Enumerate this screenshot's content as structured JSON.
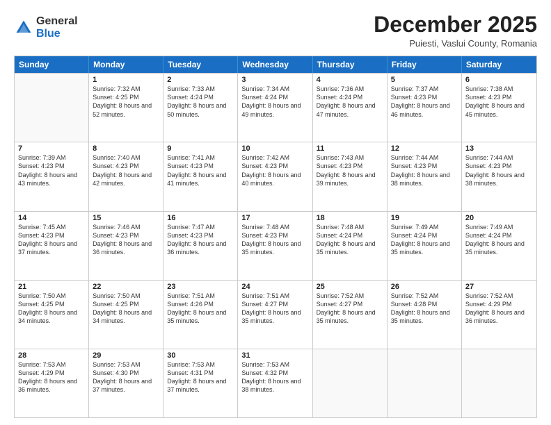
{
  "logo": {
    "general": "General",
    "blue": "Blue"
  },
  "title": "December 2025",
  "location": "Puiesti, Vaslui County, Romania",
  "days_of_week": [
    "Sunday",
    "Monday",
    "Tuesday",
    "Wednesday",
    "Thursday",
    "Friday",
    "Saturday"
  ],
  "weeks": [
    [
      {
        "day": "",
        "sunrise": "",
        "sunset": "",
        "daylight": ""
      },
      {
        "day": "1",
        "sunrise": "7:32 AM",
        "sunset": "4:25 PM",
        "daylight": "8 hours and 52 minutes."
      },
      {
        "day": "2",
        "sunrise": "7:33 AM",
        "sunset": "4:24 PM",
        "daylight": "8 hours and 50 minutes."
      },
      {
        "day": "3",
        "sunrise": "7:34 AM",
        "sunset": "4:24 PM",
        "daylight": "8 hours and 49 minutes."
      },
      {
        "day": "4",
        "sunrise": "7:36 AM",
        "sunset": "4:24 PM",
        "daylight": "8 hours and 47 minutes."
      },
      {
        "day": "5",
        "sunrise": "7:37 AM",
        "sunset": "4:23 PM",
        "daylight": "8 hours and 46 minutes."
      },
      {
        "day": "6",
        "sunrise": "7:38 AM",
        "sunset": "4:23 PM",
        "daylight": "8 hours and 45 minutes."
      }
    ],
    [
      {
        "day": "7",
        "sunrise": "7:39 AM",
        "sunset": "4:23 PM",
        "daylight": "8 hours and 43 minutes."
      },
      {
        "day": "8",
        "sunrise": "7:40 AM",
        "sunset": "4:23 PM",
        "daylight": "8 hours and 42 minutes."
      },
      {
        "day": "9",
        "sunrise": "7:41 AM",
        "sunset": "4:23 PM",
        "daylight": "8 hours and 41 minutes."
      },
      {
        "day": "10",
        "sunrise": "7:42 AM",
        "sunset": "4:23 PM",
        "daylight": "8 hours and 40 minutes."
      },
      {
        "day": "11",
        "sunrise": "7:43 AM",
        "sunset": "4:23 PM",
        "daylight": "8 hours and 39 minutes."
      },
      {
        "day": "12",
        "sunrise": "7:44 AM",
        "sunset": "4:23 PM",
        "daylight": "8 hours and 38 minutes."
      },
      {
        "day": "13",
        "sunrise": "7:44 AM",
        "sunset": "4:23 PM",
        "daylight": "8 hours and 38 minutes."
      }
    ],
    [
      {
        "day": "14",
        "sunrise": "7:45 AM",
        "sunset": "4:23 PM",
        "daylight": "8 hours and 37 minutes."
      },
      {
        "day": "15",
        "sunrise": "7:46 AM",
        "sunset": "4:23 PM",
        "daylight": "8 hours and 36 minutes."
      },
      {
        "day": "16",
        "sunrise": "7:47 AM",
        "sunset": "4:23 PM",
        "daylight": "8 hours and 36 minutes."
      },
      {
        "day": "17",
        "sunrise": "7:48 AM",
        "sunset": "4:23 PM",
        "daylight": "8 hours and 35 minutes."
      },
      {
        "day": "18",
        "sunrise": "7:48 AM",
        "sunset": "4:24 PM",
        "daylight": "8 hours and 35 minutes."
      },
      {
        "day": "19",
        "sunrise": "7:49 AM",
        "sunset": "4:24 PM",
        "daylight": "8 hours and 35 minutes."
      },
      {
        "day": "20",
        "sunrise": "7:49 AM",
        "sunset": "4:24 PM",
        "daylight": "8 hours and 35 minutes."
      }
    ],
    [
      {
        "day": "21",
        "sunrise": "7:50 AM",
        "sunset": "4:25 PM",
        "daylight": "8 hours and 34 minutes."
      },
      {
        "day": "22",
        "sunrise": "7:50 AM",
        "sunset": "4:25 PM",
        "daylight": "8 hours and 34 minutes."
      },
      {
        "day": "23",
        "sunrise": "7:51 AM",
        "sunset": "4:26 PM",
        "daylight": "8 hours and 35 minutes."
      },
      {
        "day": "24",
        "sunrise": "7:51 AM",
        "sunset": "4:27 PM",
        "daylight": "8 hours and 35 minutes."
      },
      {
        "day": "25",
        "sunrise": "7:52 AM",
        "sunset": "4:27 PM",
        "daylight": "8 hours and 35 minutes."
      },
      {
        "day": "26",
        "sunrise": "7:52 AM",
        "sunset": "4:28 PM",
        "daylight": "8 hours and 35 minutes."
      },
      {
        "day": "27",
        "sunrise": "7:52 AM",
        "sunset": "4:29 PM",
        "daylight": "8 hours and 36 minutes."
      }
    ],
    [
      {
        "day": "28",
        "sunrise": "7:53 AM",
        "sunset": "4:29 PM",
        "daylight": "8 hours and 36 minutes."
      },
      {
        "day": "29",
        "sunrise": "7:53 AM",
        "sunset": "4:30 PM",
        "daylight": "8 hours and 37 minutes."
      },
      {
        "day": "30",
        "sunrise": "7:53 AM",
        "sunset": "4:31 PM",
        "daylight": "8 hours and 37 minutes."
      },
      {
        "day": "31",
        "sunrise": "7:53 AM",
        "sunset": "4:32 PM",
        "daylight": "8 hours and 38 minutes."
      },
      {
        "day": "",
        "sunrise": "",
        "sunset": "",
        "daylight": ""
      },
      {
        "day": "",
        "sunrise": "",
        "sunset": "",
        "daylight": ""
      },
      {
        "day": "",
        "sunrise": "",
        "sunset": "",
        "daylight": ""
      }
    ]
  ]
}
